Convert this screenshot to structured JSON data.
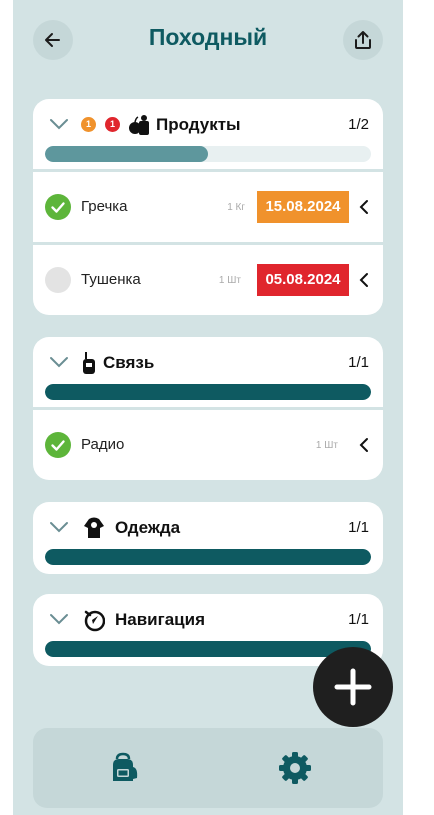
{
  "header": {
    "title": "Походный",
    "back_icon": "arrow-left-icon",
    "share_icon": "share-icon"
  },
  "categories": [
    {
      "label": "Продукты",
      "count": "1/2",
      "icon": "apple-bag-icon",
      "badges": [
        "1",
        "1"
      ],
      "progress": 0.5,
      "bar_color": "#5e979d",
      "items": [
        {
          "name": "Гречка",
          "qty": "1 Кг",
          "date": "15.08.2024",
          "date_color": "#f0922c",
          "checked": true
        },
        {
          "name": "Тушенка",
          "qty": "1 Шт",
          "date": "05.08.2024",
          "date_color": "#e0262d",
          "checked": false
        }
      ]
    },
    {
      "label": "Связь",
      "count": "1/1",
      "icon": "walkie-talkie-icon",
      "progress": 1.0,
      "bar_color": "#0e5a61",
      "items": [
        {
          "name": "Радио",
          "qty": "1 Шт",
          "checked": true
        }
      ]
    },
    {
      "label": "Одежда",
      "count": "1/1",
      "icon": "shirt-icon",
      "progress": 1.0,
      "bar_color": "#0e5a61"
    },
    {
      "label": "Навигация",
      "count": "1/1",
      "icon": "compass-icon",
      "progress": 1.0,
      "bar_color": "#0e5a61"
    }
  ],
  "fab": {
    "icon": "plus-icon"
  },
  "bottom_nav": {
    "left_icon": "backpack-icon",
    "right_icon": "gear-icon"
  },
  "colors": {
    "accent": "#0e5a61",
    "background": "#d3e3e4",
    "check_green": "#5db53a"
  }
}
